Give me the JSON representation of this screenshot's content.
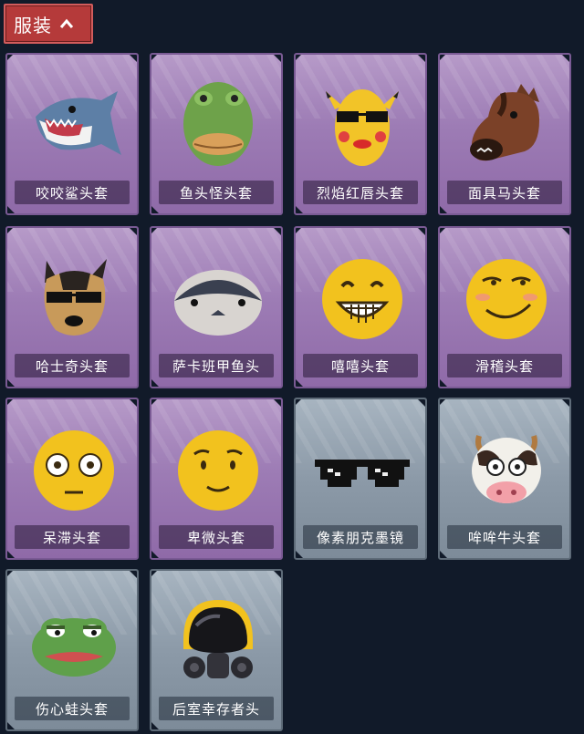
{
  "tab": {
    "label": "服装",
    "icon": "chevron-up-icon"
  },
  "items": [
    {
      "name": "咬咬鲨头套",
      "rarity": "purple",
      "icon": "shark-head-icon"
    },
    {
      "name": "鱼头怪头套",
      "rarity": "purple",
      "icon": "fish-head-icon"
    },
    {
      "name": "烈焰红唇头套",
      "rarity": "purple",
      "icon": "pikachu-lips-head-icon"
    },
    {
      "name": "面具马头套",
      "rarity": "purple",
      "icon": "horse-head-icon"
    },
    {
      "name": "哈士奇头套",
      "rarity": "purple",
      "icon": "husky-head-icon"
    },
    {
      "name": "萨卡班甲鱼头",
      "rarity": "purple",
      "icon": "sacabambaspis-head-icon"
    },
    {
      "name": "嘻嘻头套",
      "rarity": "purple",
      "icon": "grin-emoji-head-icon"
    },
    {
      "name": "滑稽头套",
      "rarity": "purple",
      "icon": "smirk-emoji-head-icon"
    },
    {
      "name": "呆滞头套",
      "rarity": "purple",
      "icon": "stunned-emoji-head-icon"
    },
    {
      "name": "卑微头套",
      "rarity": "purple",
      "icon": "humble-emoji-head-icon"
    },
    {
      "name": "像素朋克墨镜",
      "rarity": "gray",
      "icon": "pixel-sunglasses-icon"
    },
    {
      "name": "哞哞牛头套",
      "rarity": "gray",
      "icon": "cow-head-icon"
    },
    {
      "name": "伤心蛙头套",
      "rarity": "gray",
      "icon": "sad-frog-head-icon"
    },
    {
      "name": "后室幸存者头",
      "rarity": "gray",
      "icon": "gas-mask-helmet-icon"
    }
  ]
}
